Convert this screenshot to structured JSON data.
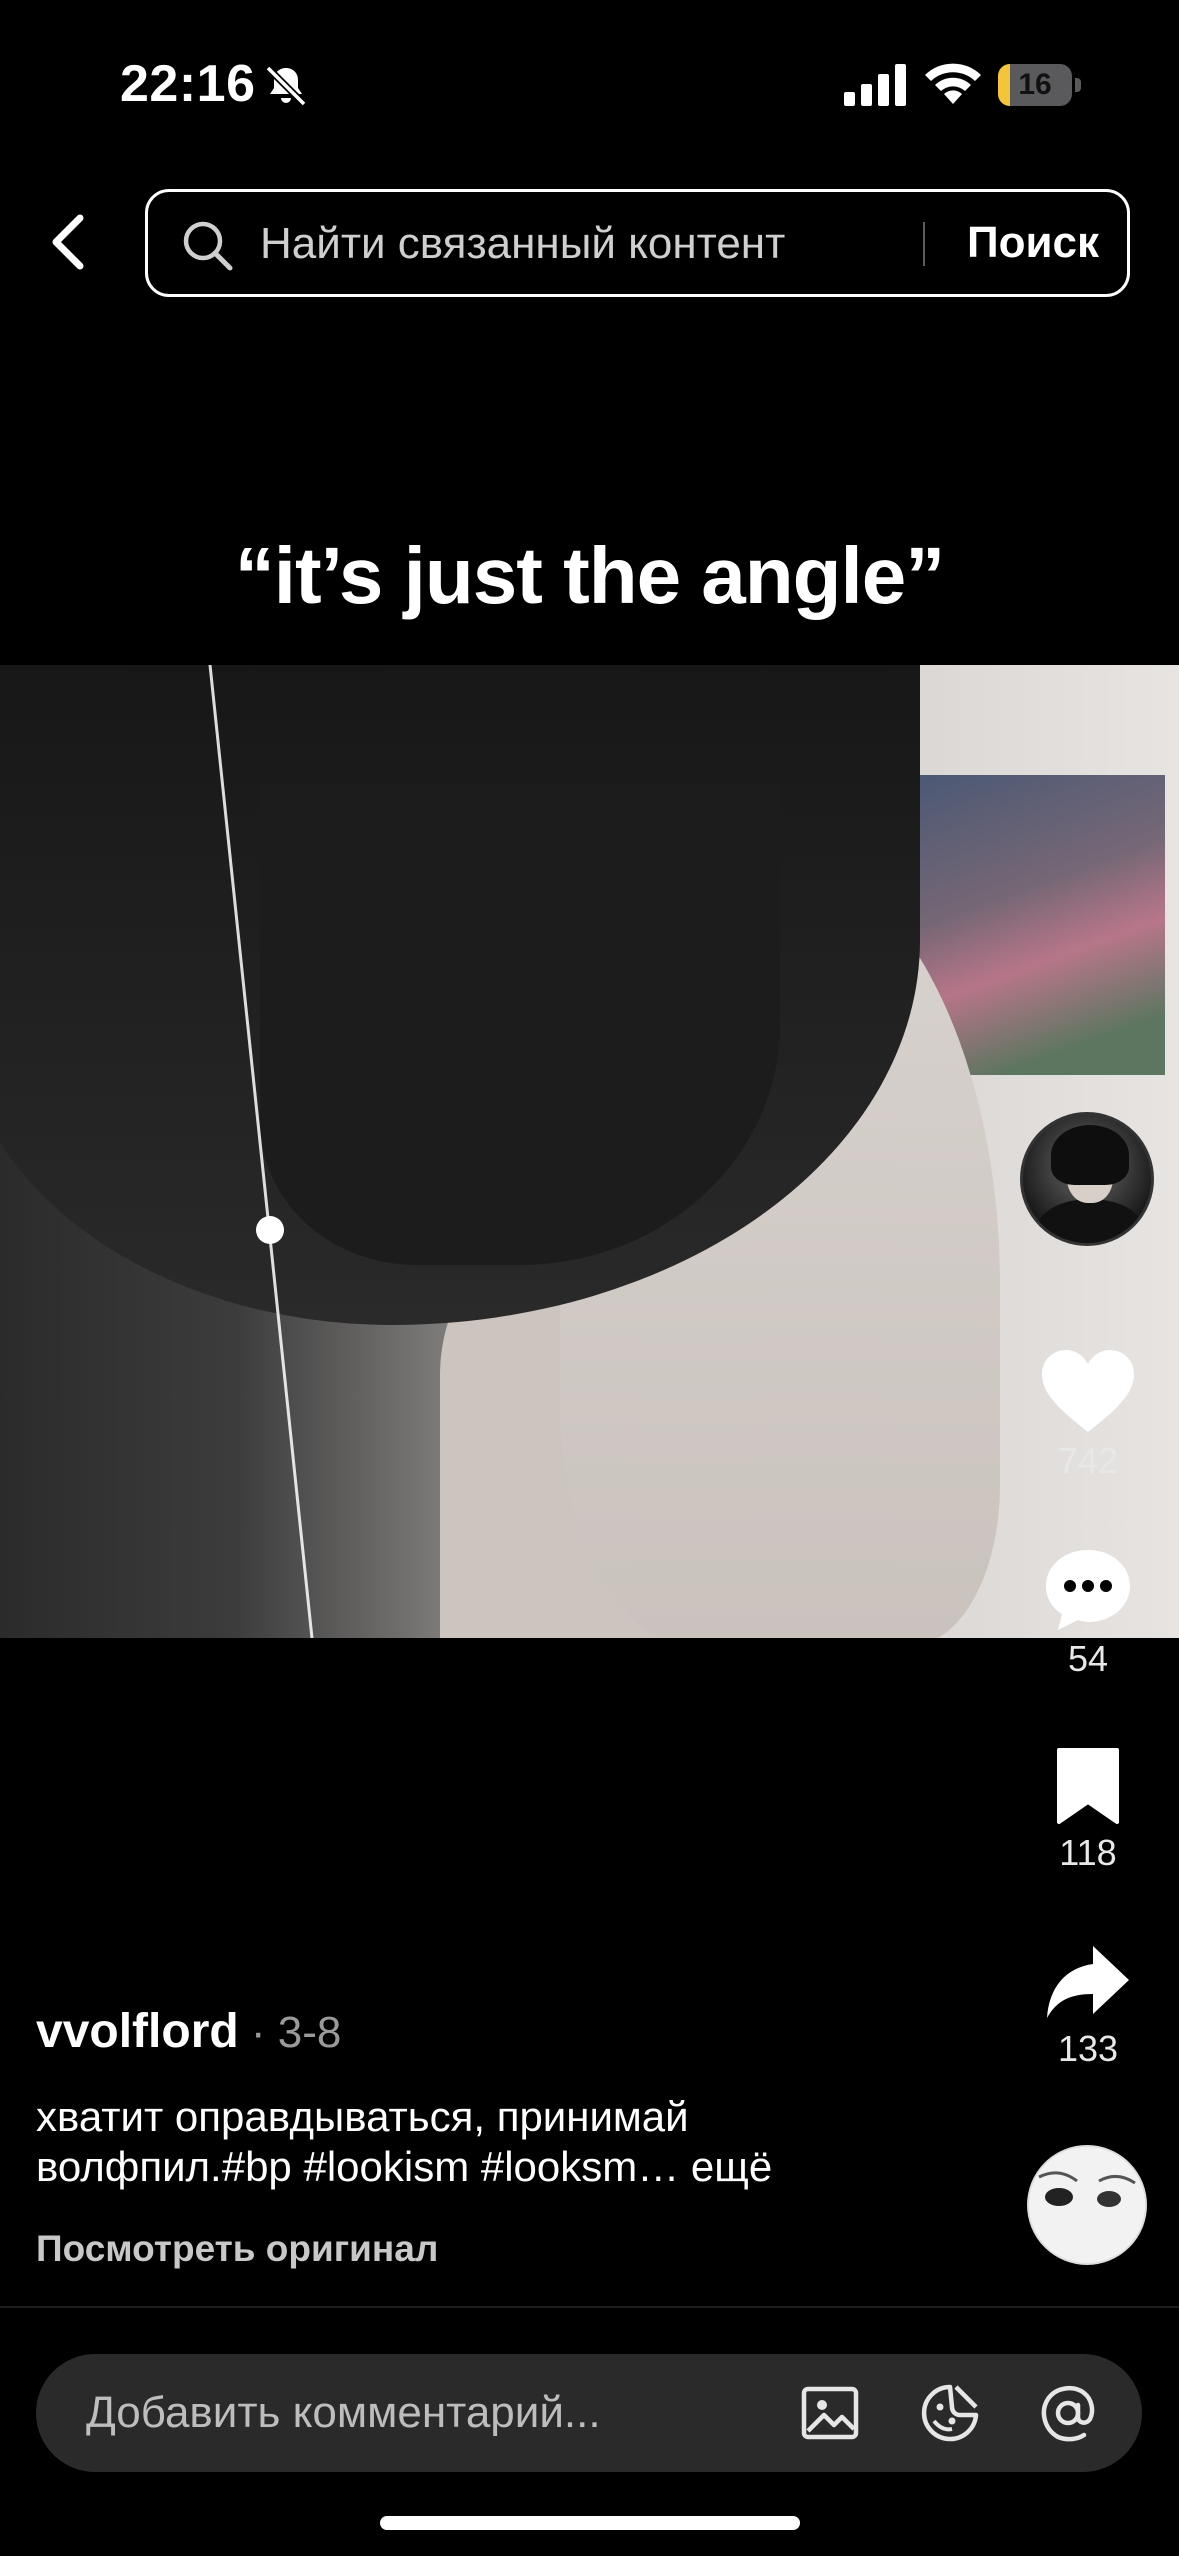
{
  "status_bar": {
    "time": "22:16",
    "battery_level": "16",
    "battery_fraction": 0.16,
    "icons": [
      "bell-slash-icon",
      "cellular-signal-icon",
      "wifi-icon",
      "battery-icon"
    ]
  },
  "header": {
    "back_icon": "chevron-left-icon",
    "search": {
      "placeholder": "Найти связанный контент",
      "value": "",
      "button_label": "Поиск",
      "icon": "search-icon"
    }
  },
  "video": {
    "caption": "“it’s just the angle”"
  },
  "actions": {
    "likes": "742",
    "comments": "54",
    "saves": "118",
    "shares": "133"
  },
  "post": {
    "author": "vvolflord",
    "date_separator": " · ",
    "date": "3-8",
    "description": "хватит оправдываться, принимай волфпил.#bp #lookism #looksm",
    "more_label": "… ещё",
    "view_original": "Посмотреть оригинал"
  },
  "comment_bar": {
    "placeholder": "Добавить комментарий...",
    "icons": [
      "image-icon",
      "sticker-icon",
      "mention-icon"
    ]
  },
  "colors": {
    "background": "#000000",
    "battery_fill": "#f5c43a",
    "comment_bar_bg": "#2a2a2a",
    "secondary_text": "#9a9a9a"
  }
}
